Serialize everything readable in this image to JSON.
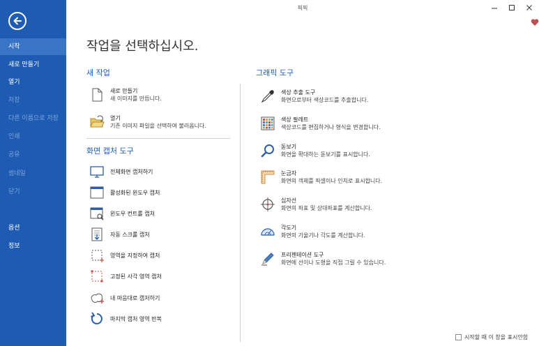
{
  "window": {
    "title": "픽픽"
  },
  "sidebar": {
    "items": [
      {
        "label": "시작"
      },
      {
        "label": "새로 만들기"
      },
      {
        "label": "열기"
      },
      {
        "label": "저장"
      },
      {
        "label": "다른 이름으로 저장"
      },
      {
        "label": "인쇄"
      },
      {
        "label": "공유"
      },
      {
        "label": "썸네일"
      },
      {
        "label": "닫기"
      },
      {
        "label": "옵션"
      },
      {
        "label": "정보"
      }
    ]
  },
  "main": {
    "title": "작업을 선택하십시오.",
    "new_task": {
      "heading": "새 작업",
      "items": [
        {
          "title": "새로 만들기",
          "desc": "새 이미지를 만듭니다."
        },
        {
          "title": "열기",
          "desc": "기존 이미지 파일을 선택하여 불러옵니다."
        }
      ]
    },
    "capture": {
      "heading": "화면 캡처 도구",
      "items": [
        {
          "title": "전체화면 캡처하기"
        },
        {
          "title": "활성화된 윈도우 캡처"
        },
        {
          "title": "윈도우 컨트롤 캡처"
        },
        {
          "title": "자동 스크롤 캡처"
        },
        {
          "title": "영역을 지정하여 캡처"
        },
        {
          "title": "고정된 사각 영역 캡처"
        },
        {
          "title": "내 마음대로 캡처하기"
        },
        {
          "title": "마지막 캡처 영역 반복"
        }
      ]
    },
    "graphics": {
      "heading": "그래픽 도구",
      "items": [
        {
          "title": "색상 추출 도구",
          "desc": "화면으로부터 색상코드를 추출합니다."
        },
        {
          "title": "색상 팔레트",
          "desc": "색상코드를 편집하거나 형식을 변경합니다."
        },
        {
          "title": "돋보기",
          "desc": "화면을 확대하는 돋보기를 표시합니다."
        },
        {
          "title": "눈금자",
          "desc": "화면의 객체를 픽셀이나 인치로 표시합니다."
        },
        {
          "title": "십자선",
          "desc": "화면의 좌표 및 상대좌표를 계산합니다."
        },
        {
          "title": "각도기",
          "desc": "화면의 기울기나 각도를 계산합니다."
        },
        {
          "title": "프리젠테이션 도구",
          "desc": "화면에 선이나 도형을 직접 그릴 수 있습니다."
        }
      ]
    },
    "startup_label": "시작할 때 이 창을 표시안함"
  },
  "colors": {
    "sidebar": "#1e5cb3",
    "accent": "#1e5cb3",
    "heart": "#c0504d"
  }
}
